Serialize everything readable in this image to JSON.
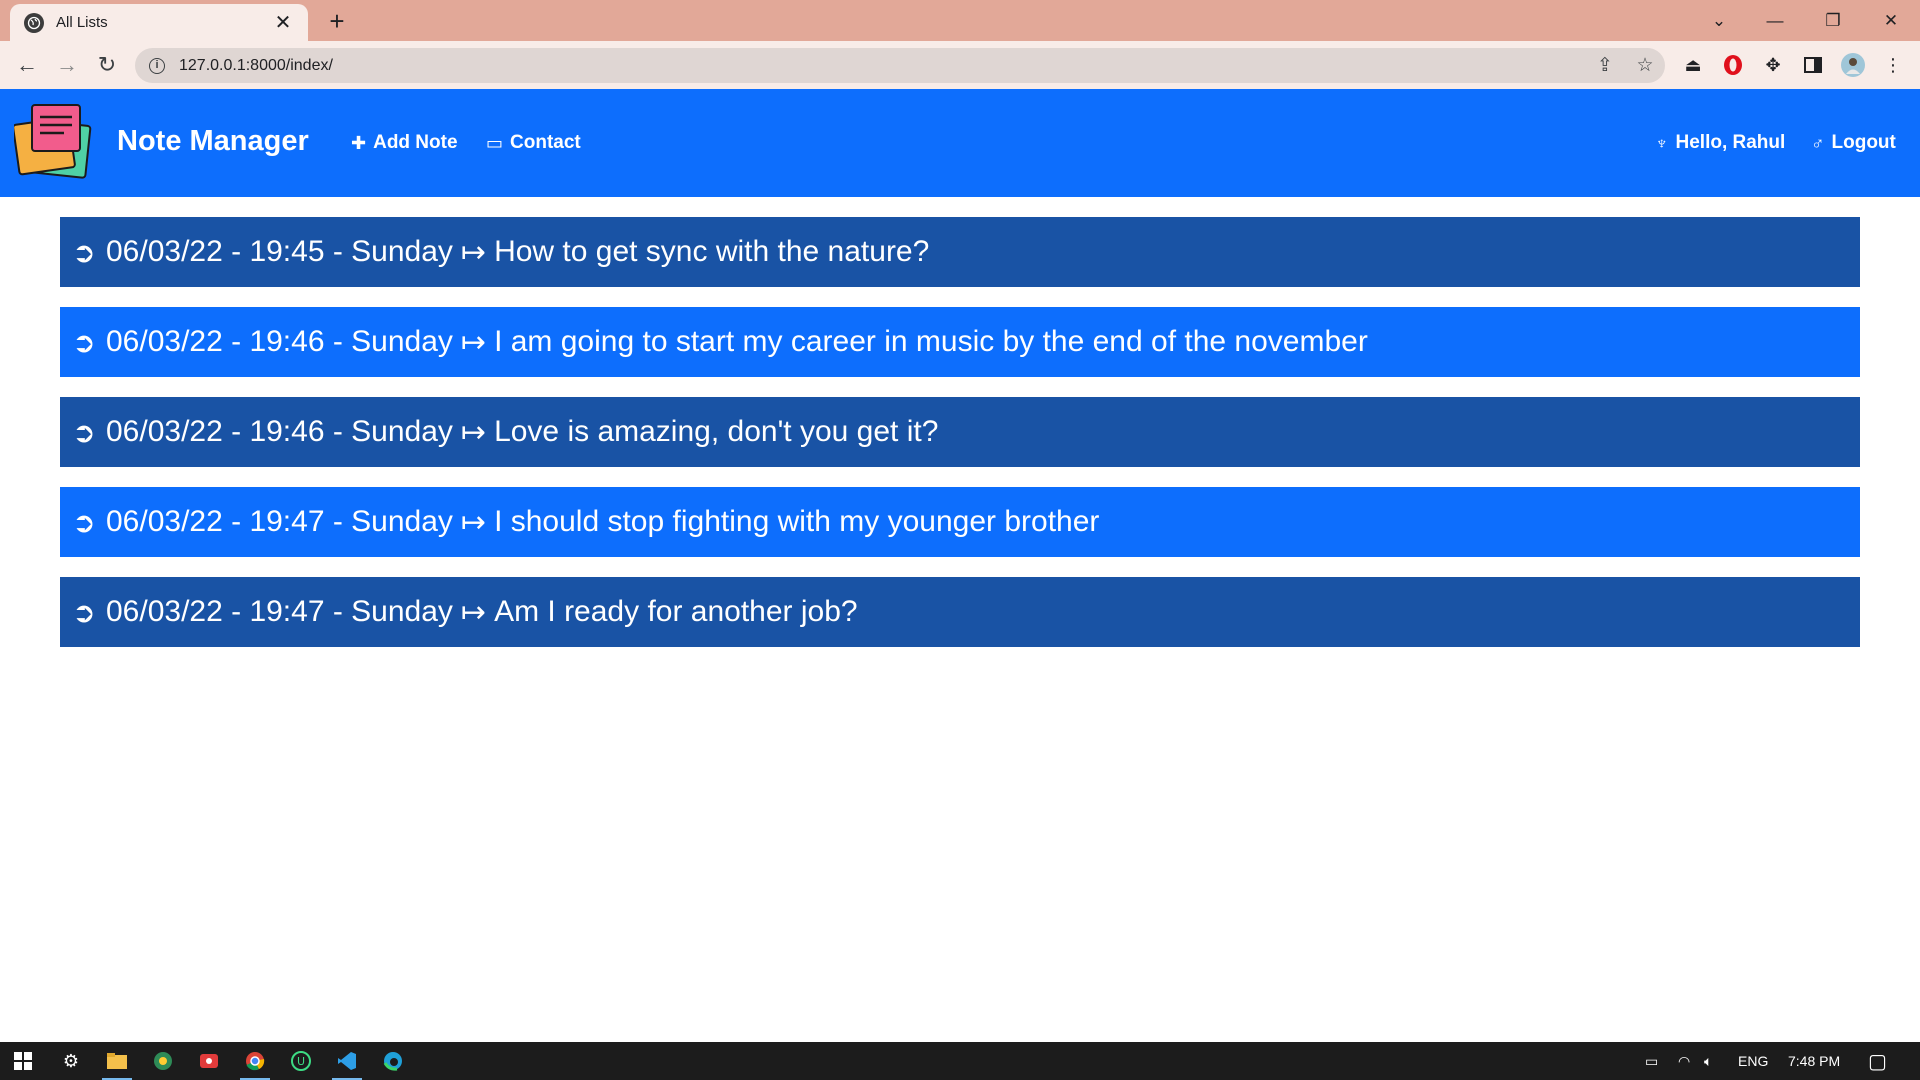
{
  "browser": {
    "tab_title": "All Lists",
    "tab_close": "✕",
    "new_tab": "+",
    "url": "127.0.0.1:8000/index/",
    "window_controls": {
      "dropdown": "⌄",
      "minimize": "—",
      "restore": "❐",
      "close": "✕"
    }
  },
  "app": {
    "brand": "Note Manager",
    "nav": {
      "add_note": "Add Note",
      "contact": "Contact",
      "greeting": "Hello, Rahul",
      "logout": "Logout"
    },
    "icons": {
      "add_note": "✚",
      "contact": "▭",
      "greeting": "♆",
      "logout": "♂",
      "note_bullet": "➲",
      "arrow": "↦"
    }
  },
  "notes": [
    {
      "timestamp": "06/03/22 - 19:45 - Sunday",
      "text": "How to get sync with the nature?",
      "shade": "dark"
    },
    {
      "timestamp": "06/03/22 - 19:46 - Sunday",
      "text": "I am going to start my career in music by the end of the november",
      "shade": "light"
    },
    {
      "timestamp": "06/03/22 - 19:46 - Sunday",
      "text": "Love is amazing, don't you get it?",
      "shade": "dark"
    },
    {
      "timestamp": "06/03/22 - 19:47 - Sunday",
      "text": "I should stop fighting with my younger brother",
      "shade": "light"
    },
    {
      "timestamp": "06/03/22 - 19:47 - Sunday",
      "text": "Am I ready for another job?",
      "shade": "dark"
    }
  ],
  "taskbar": {
    "language": "ENG",
    "time": "7:48 PM"
  },
  "colors": {
    "navbar": "#0d6efd",
    "note_dark": "#1953a5",
    "note_light": "#0d6efd",
    "tabbar": "#e2a898"
  }
}
